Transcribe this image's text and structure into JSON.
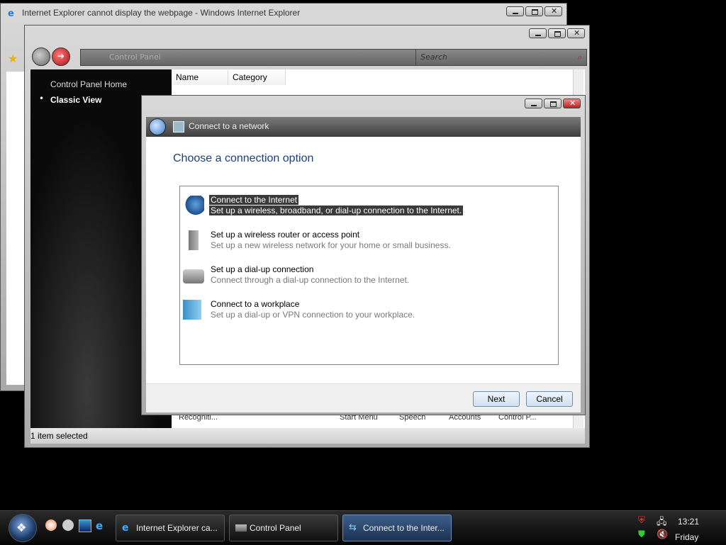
{
  "ie_window": {
    "title": "Internet Explorer cannot display the webpage - Windows Internet Explorer"
  },
  "control_panel": {
    "address_text": "Control Panel",
    "search_placeholder": "Search",
    "nav": {
      "home": "Control Panel Home",
      "classic": "Classic View"
    },
    "columns": [
      "Name",
      "Category"
    ],
    "bottom_labels": [
      "Recogniti...",
      "Start Menu",
      "Speech",
      "Accounts",
      "Control P..."
    ],
    "status": "1 item selected"
  },
  "dialog": {
    "header_title": "Connect to a network",
    "heading": "Choose a connection option",
    "options": [
      {
        "title": "Connect to the Internet",
        "desc": "Set up a wireless, broadband, or dial-up connection to the Internet.",
        "icon": "globe-icon",
        "selected": true
      },
      {
        "title": "Set up a wireless router or access point",
        "desc": "Set up a new wireless network for your home or small business.",
        "icon": "router-icon",
        "selected": false
      },
      {
        "title": "Set up a dial-up connection",
        "desc": "Connect through a dial-up connection to the Internet.",
        "icon": "phone-icon",
        "selected": false
      },
      {
        "title": "Connect to a workplace",
        "desc": "Set up a dial-up or VPN connection to your workplace.",
        "icon": "workplace-icon",
        "selected": false
      }
    ],
    "next_label": "Next",
    "cancel_label": "Cancel"
  },
  "taskbar": {
    "tasks": [
      {
        "label": "Internet Explorer ca...",
        "icon": "ie-icon"
      },
      {
        "label": "Control Panel",
        "icon": "control-panel-icon"
      },
      {
        "label": "Connect to the Inter...",
        "icon": "network-icon"
      }
    ],
    "time": "13:21",
    "day": "Friday"
  }
}
